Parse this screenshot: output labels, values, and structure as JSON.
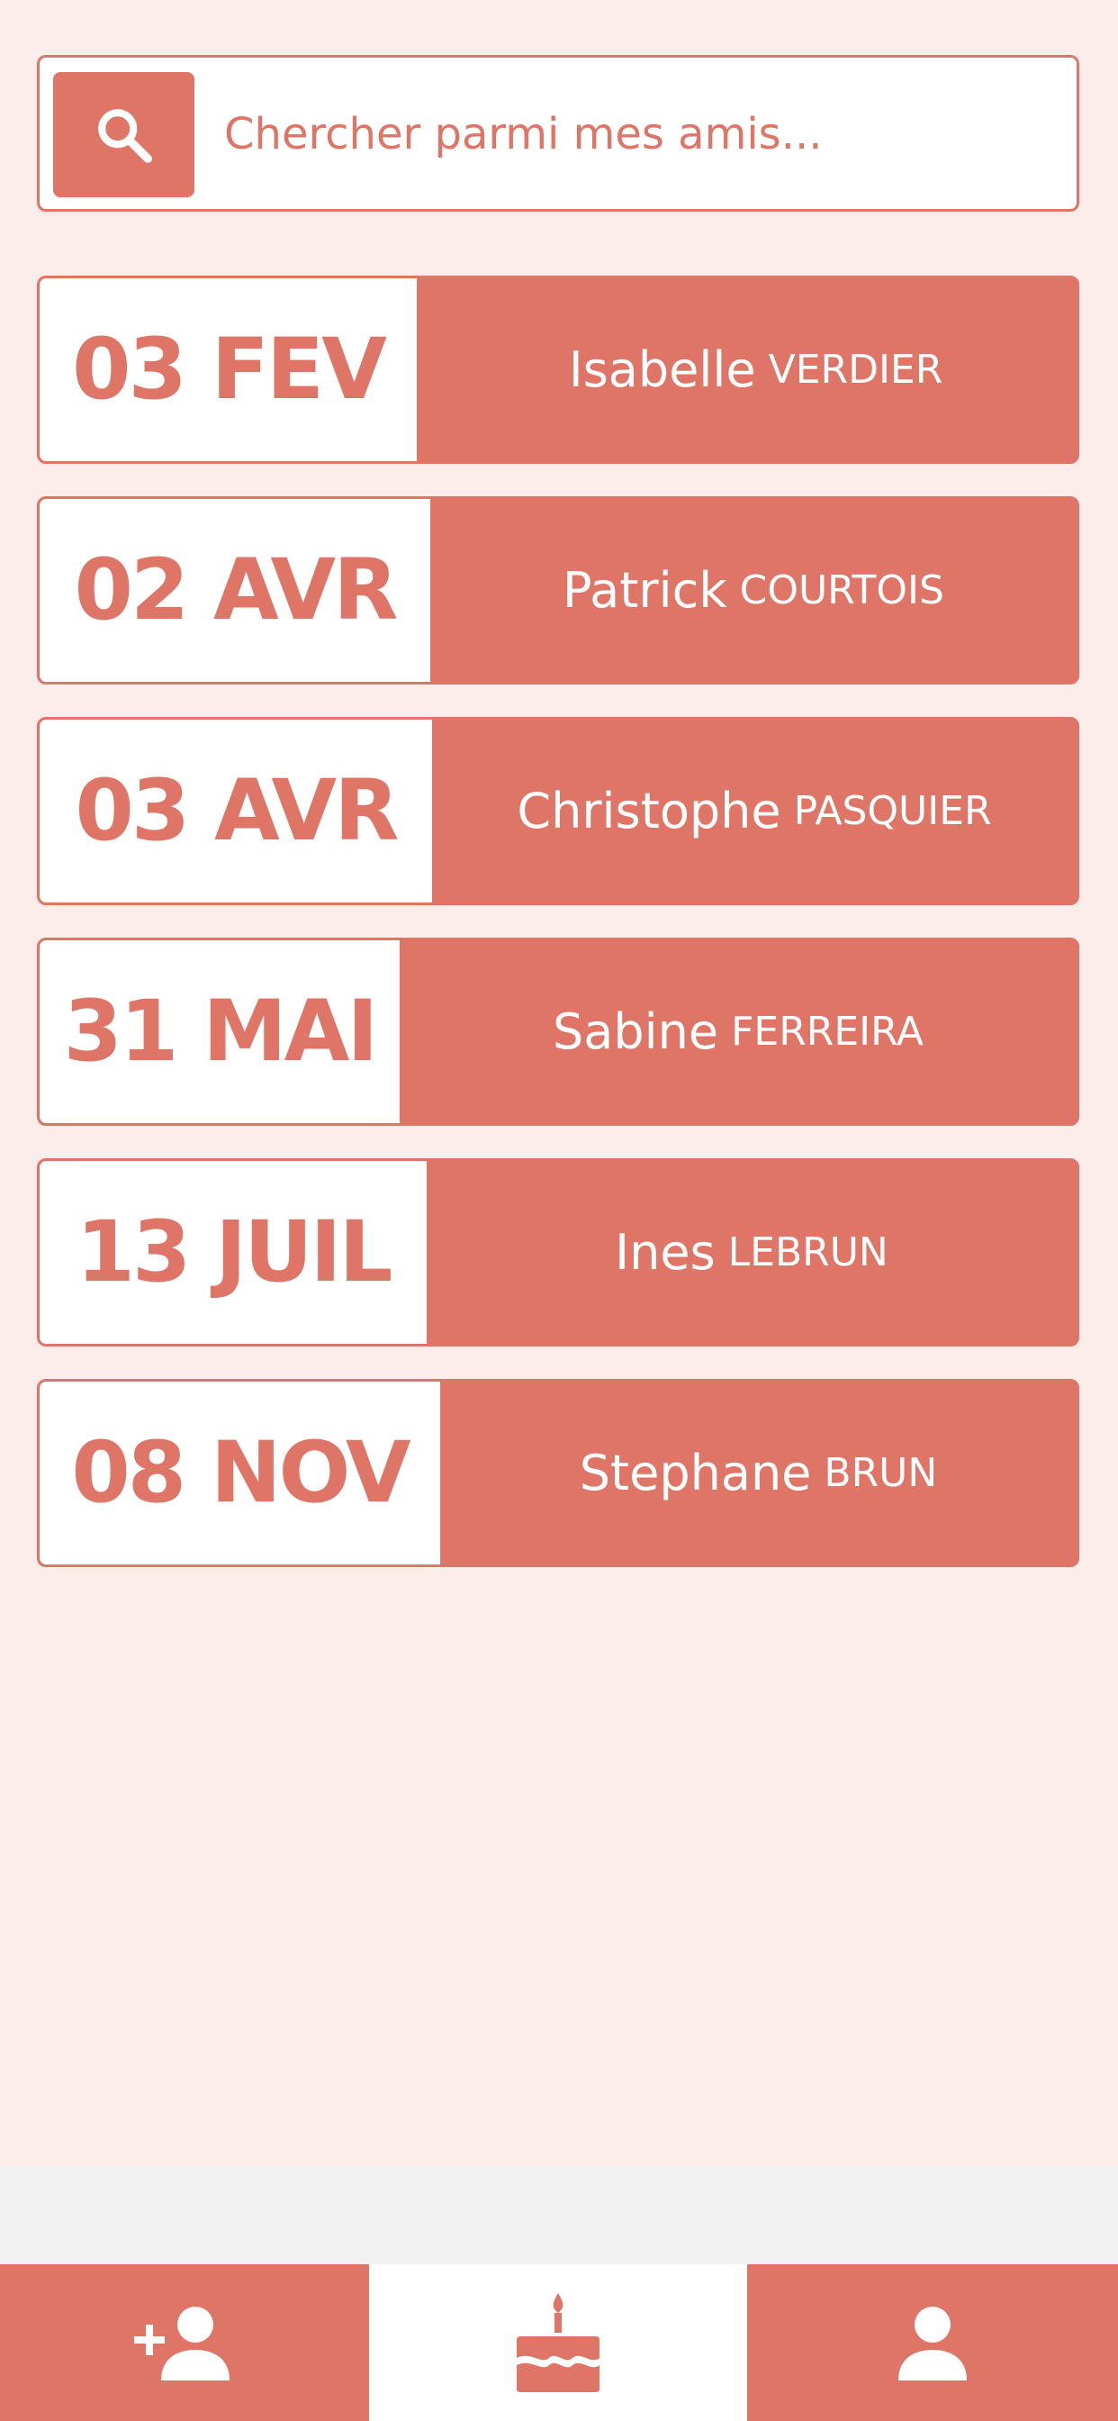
{
  "search": {
    "placeholder": "Chercher parmi mes amis...",
    "icon": "search-icon"
  },
  "birthdays": [
    {
      "date": "03 FEV",
      "first_name": "Isabelle",
      "last_name": "VERDIER"
    },
    {
      "date": "02 AVR",
      "first_name": "Patrick",
      "last_name": "COURTOIS"
    },
    {
      "date": "03 AVR",
      "first_name": "Christophe",
      "last_name": "PASQUIER"
    },
    {
      "date": "31 MAI",
      "first_name": "Sabine",
      "last_name": "FERREIRA"
    },
    {
      "date": "13 JUIL",
      "first_name": "Ines",
      "last_name": "LEBRUN"
    },
    {
      "date": "08 NOV",
      "first_name": "Stephane",
      "last_name": "BRUN"
    }
  ],
  "bottom_nav": {
    "items": [
      {
        "icon": "add-friend-icon",
        "active": false
      },
      {
        "icon": "birthday-cake-icon",
        "active": true
      },
      {
        "icon": "profile-icon",
        "active": false
      }
    ]
  },
  "colors": {
    "accent": "#df7566",
    "background": "#fcedea",
    "surface": "#ffffff"
  }
}
